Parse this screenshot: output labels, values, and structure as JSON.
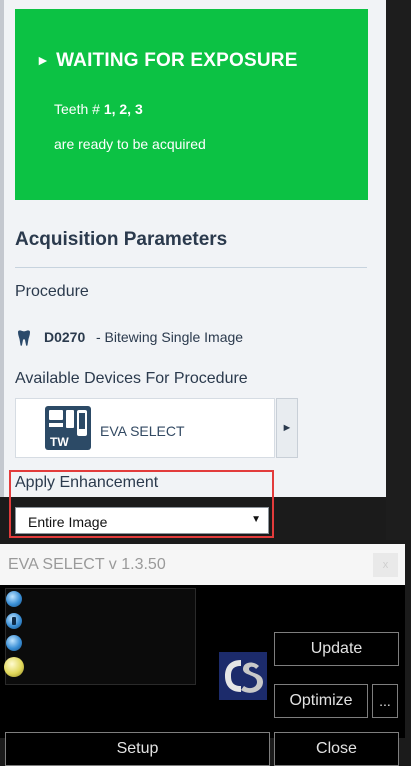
{
  "status": {
    "title": "WAITING FOR EXPOSURE",
    "arrow": "►",
    "teeth_prefix": "Teeth # ",
    "teeth_numbers": "1, 2, 3",
    "message": "are ready to be acquired",
    "color": "#0cc244"
  },
  "acquisition": {
    "heading": "Acquisition Parameters",
    "procedure_label": "Procedure",
    "procedure_code": "D0270",
    "procedure_desc": "- Bitewing Single Image",
    "devices_label": "Available Devices For Procedure",
    "device_name": "EVA SELECT",
    "device_next": "►",
    "enhancement_label": "Apply Enhancement",
    "enhancement_value": "Entire Image",
    "enhancement_caret": "▼",
    "highlight_color": "#e23b3b"
  },
  "eva_window": {
    "title": "EVA SELECT v 1.3.50",
    "close_x": "x",
    "buttons": {
      "update": "Update",
      "optimize": "Optimize",
      "more": "...",
      "setup": "Setup",
      "close": "Close"
    }
  }
}
